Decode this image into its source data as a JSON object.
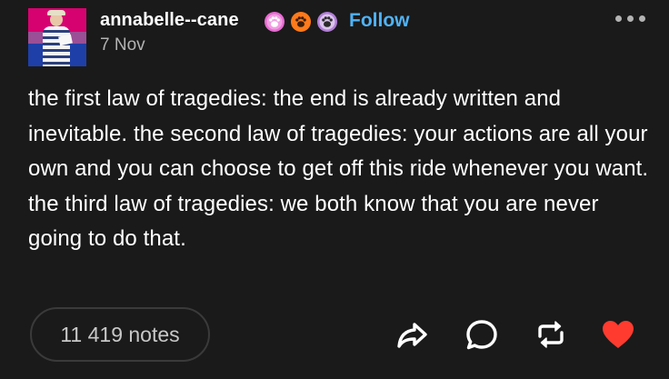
{
  "post": {
    "username": "annabelle--cane",
    "follow_label": "Follow",
    "date": "7 Nov",
    "text": "the first law of tragedies: the end is already written and inevitable. the second law of tragedies: your actions are all your own and you can choose to get off this ride whenever you want. the third law of tragedies: we both know that you are never going to do that.",
    "notes": "11 419 notes"
  },
  "badges": [
    {
      "icon": "paw-badge-icon",
      "color": "#e86bd2"
    },
    {
      "icon": "paw-badge-icon",
      "color": "#ff7a1a"
    },
    {
      "icon": "paw-badge-icon",
      "color": "#b27dd8"
    }
  ],
  "colors": {
    "background": "#1a1a1a",
    "follow": "#4fb3f6",
    "like": "#ff3b2f",
    "muted": "#b3b3b3"
  },
  "actions": [
    {
      "icon": "share-icon"
    },
    {
      "icon": "reply-icon"
    },
    {
      "icon": "reblog-icon"
    },
    {
      "icon": "like-icon"
    }
  ]
}
